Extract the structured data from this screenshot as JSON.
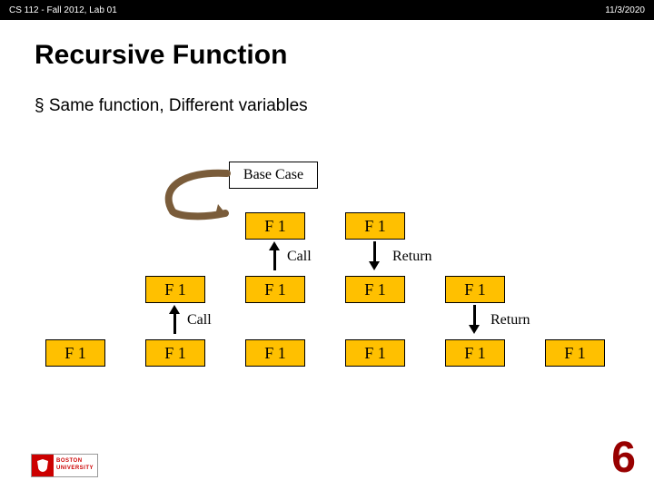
{
  "header": {
    "left": "CS 112 - Fall 2012, Lab 01",
    "right": "11/3/2020"
  },
  "title": "Recursive Function",
  "bullet": "Same function, Different variables",
  "diagram": {
    "basecase": "Base Case",
    "f1": "F 1",
    "call": "Call",
    "ret": "Return"
  },
  "logo": {
    "line1": "BOSTON",
    "line2": "UNIVERSITY"
  },
  "pagenum": "6"
}
